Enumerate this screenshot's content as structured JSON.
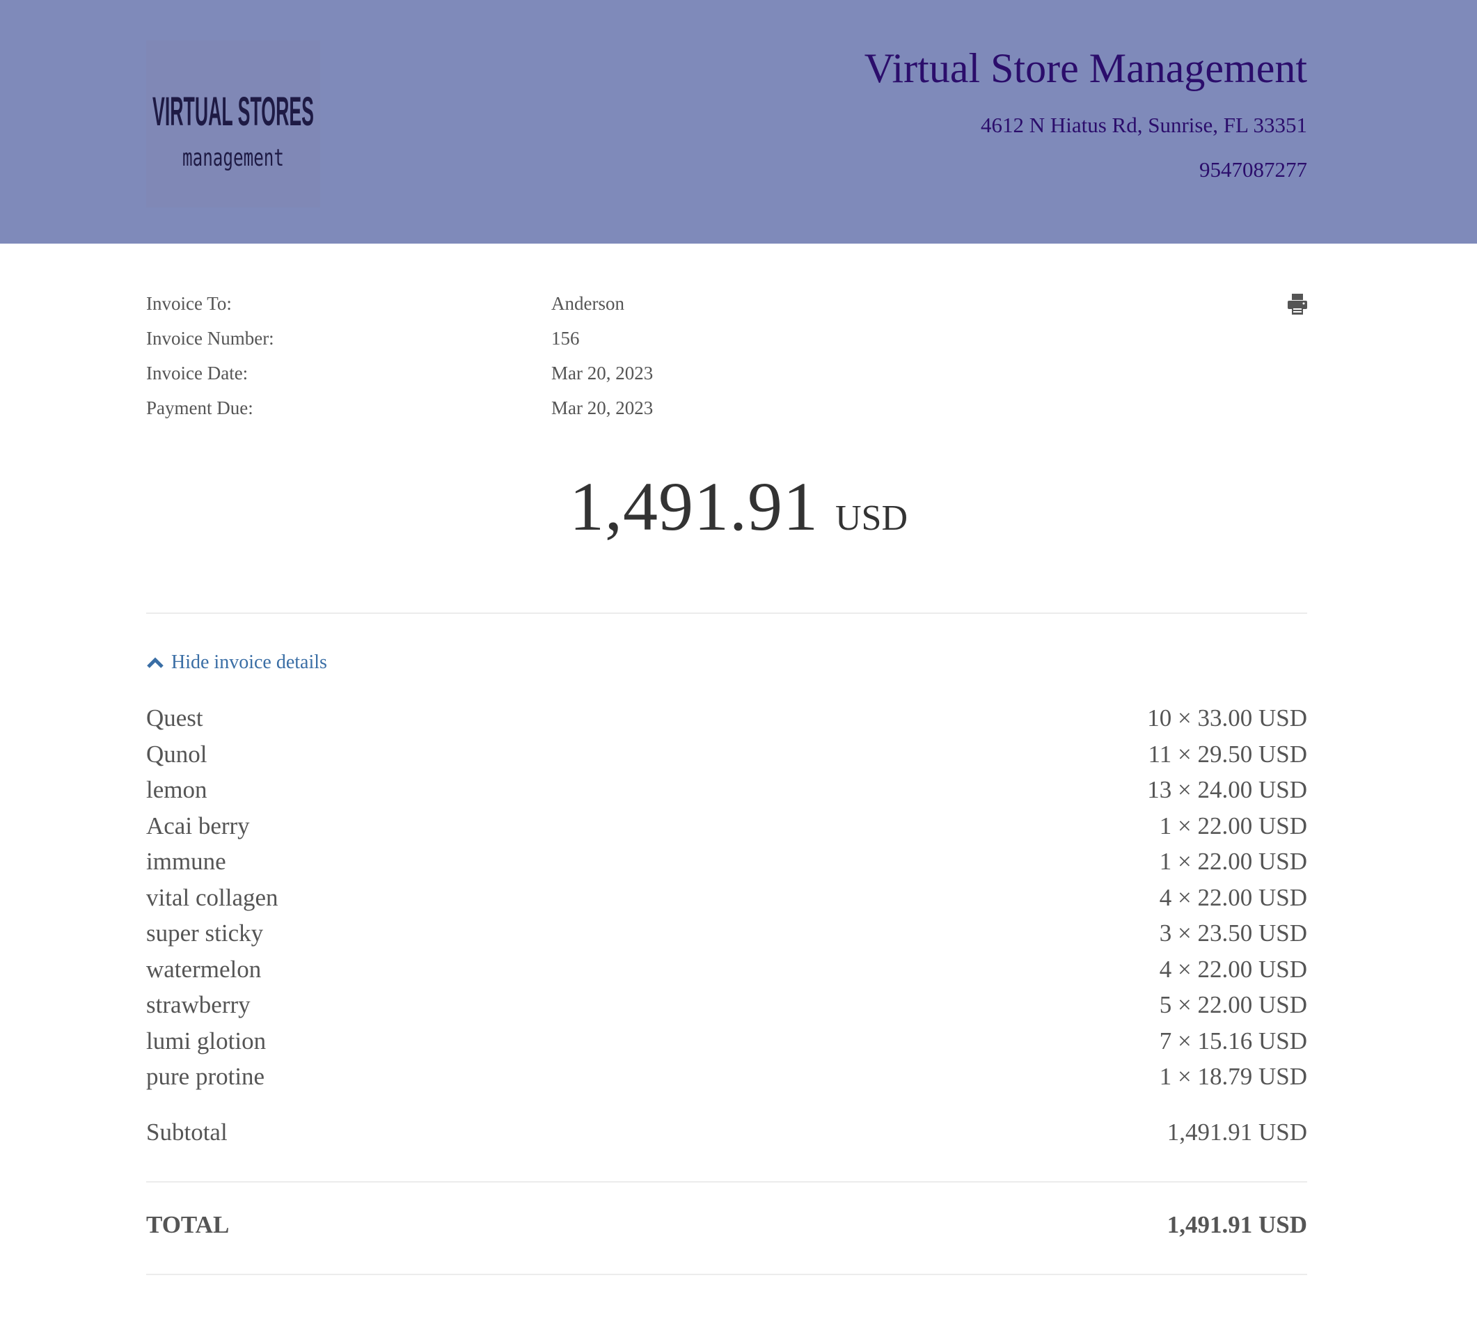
{
  "header": {
    "logo": {
      "text_top": "VIRTUAL STORES",
      "text_bottom": "management"
    },
    "company_name": "Virtual Store Management",
    "address": "4612 N Hiatus Rd, Sunrise, FL 33351",
    "phone": "9547087277",
    "background_color": "#7f8aba",
    "text_color": "#2b0d6b"
  },
  "meta": [
    {
      "label": "Invoice To:",
      "value": "Anderson"
    },
    {
      "label": "Invoice Number:",
      "value": "156"
    },
    {
      "label": "Invoice Date:",
      "value": "Mar 20, 2023"
    },
    {
      "label": "Payment Due:",
      "value": "Mar 20, 2023"
    }
  ],
  "print_icon": "printer-icon",
  "amount": {
    "value": "1,491.91",
    "currency": "USD"
  },
  "toggle": {
    "label": "Hide invoice details",
    "icon": "chevron-up-icon",
    "color": "#3a6ea5"
  },
  "items": [
    {
      "name": "Quest",
      "price": "10 × 33.00 USD"
    },
    {
      "name": "Qunol",
      "price": "11 × 29.50 USD"
    },
    {
      "name": "lemon",
      "price": "13 × 24.00 USD"
    },
    {
      "name": "Acai berry",
      "price": "1 × 22.00 USD"
    },
    {
      "name": "immune",
      "price": "1 × 22.00 USD"
    },
    {
      "name": "vital collagen",
      "price": "4 × 22.00 USD"
    },
    {
      "name": "super sticky",
      "price": "3 × 23.50 USD"
    },
    {
      "name": "watermelon",
      "price": "4 × 22.00 USD"
    },
    {
      "name": "strawberry",
      "price": "5 × 22.00 USD"
    },
    {
      "name": "lumi glotion",
      "price": "7 × 15.16 USD"
    },
    {
      "name": "pure protine",
      "price": "1 × 18.79 USD"
    }
  ],
  "subtotal": {
    "label": "Subtotal",
    "value": "1,491.91 USD"
  },
  "total": {
    "label": "TOTAL",
    "value": "1,491.91 USD"
  }
}
